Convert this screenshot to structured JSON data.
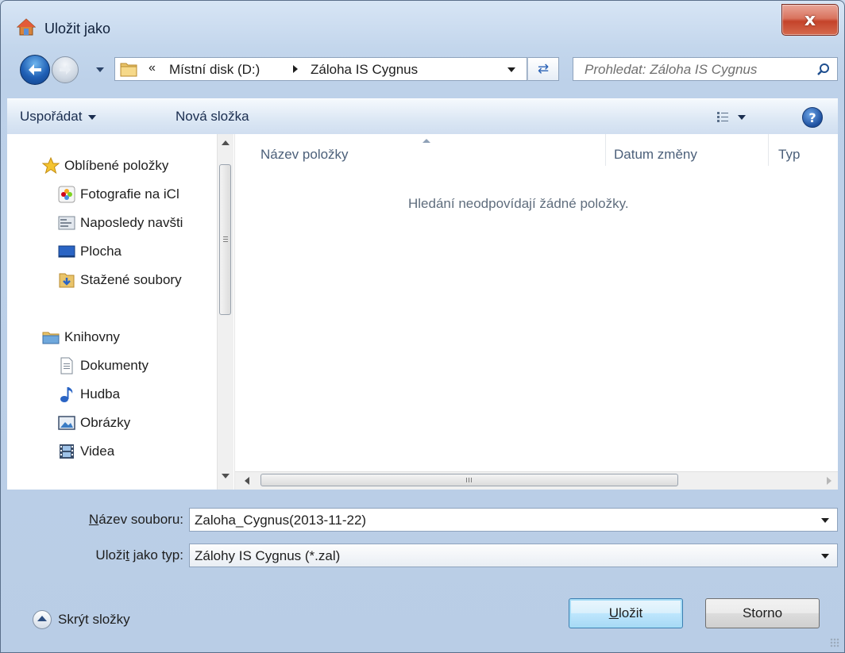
{
  "window": {
    "title": "Uložit jako",
    "close_label": "x"
  },
  "address": {
    "overflow": "«",
    "crumbs": [
      "Místní disk (D:)",
      "Záloha IS Cygnus"
    ],
    "search_placeholder": "Prohledat: Záloha IS Cygnus"
  },
  "commandbar": {
    "organize": "Uspořádat",
    "new_folder": "Nová složka",
    "help": "?"
  },
  "nav": {
    "favorites_header": "Oblíbené položky",
    "favorites": [
      "Fotografie na iCl",
      "Naposledy navšti",
      "Plocha",
      "Stažené soubory"
    ],
    "libraries_header": "Knihovny",
    "libraries": [
      "Dokumenty",
      "Hudba",
      "Obrázky",
      "Videa"
    ]
  },
  "filelist": {
    "columns": [
      "Název položky",
      "Datum změny",
      "Typ"
    ],
    "empty_message": "Hledání neodpovídají žádné položky.",
    "scroll_grip": "III"
  },
  "form": {
    "filename_label_accel": "N",
    "filename_label_rest": "ázev souboru:",
    "filename_value": "Zaloha_Cygnus(2013-11-22)",
    "type_label_pre": "Uloži",
    "type_label_accel": "t",
    "type_label_post": " jako typ:",
    "type_value": "Zálohy IS Cygnus (*.zal)"
  },
  "footer": {
    "hide_folders": "Skrýt složky",
    "save_accel": "U",
    "save_rest": "ložit",
    "cancel": "Storno"
  },
  "colors": {
    "accent": "#1f5fb5",
    "close": "#c4432a",
    "frame": "#bdd1e9"
  }
}
